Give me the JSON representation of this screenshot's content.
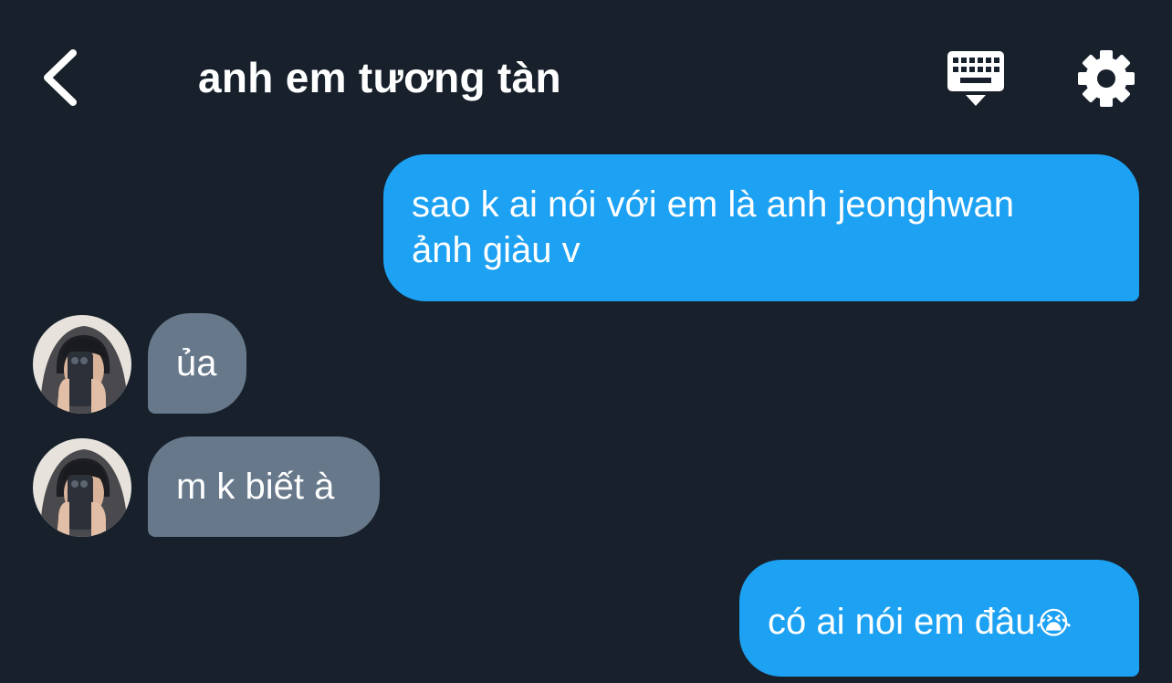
{
  "header": {
    "title": "anh em tương tàn",
    "back_icon": "chevron-left-icon",
    "keyboard_icon": "keyboard-icon",
    "settings_icon": "gear-icon"
  },
  "colors": {
    "background": "#17202b",
    "outgoing_bubble": "#1da1f2",
    "incoming_bubble": "#66788a",
    "text": "#ffffff"
  },
  "messages": [
    {
      "direction": "outgoing",
      "lines": [
        "sao k ai nói với em là anh jeonghwan",
        "ảnh giàu v"
      ]
    },
    {
      "direction": "incoming",
      "text": "ủa",
      "avatar": "avatar-icon"
    },
    {
      "direction": "incoming",
      "text": "m k biết à",
      "avatar": "avatar-icon"
    },
    {
      "direction": "outgoing",
      "text": "có ai nói em đâu",
      "emoji": "😭"
    }
  ]
}
